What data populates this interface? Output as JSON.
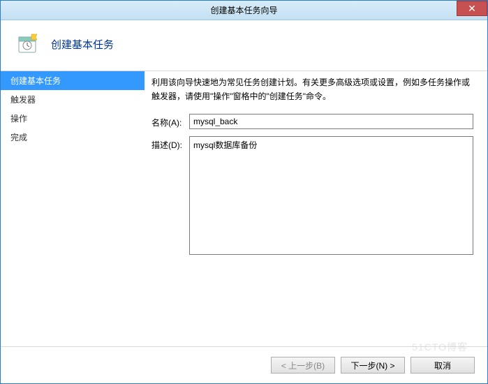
{
  "window": {
    "title": "创建基本任务向导"
  },
  "header": {
    "title": "创建基本任务"
  },
  "sidebar": {
    "items": [
      {
        "label": "创建基本任务",
        "active": true
      },
      {
        "label": "触发器",
        "active": false
      },
      {
        "label": "操作",
        "active": false
      },
      {
        "label": "完成",
        "active": false
      }
    ]
  },
  "content": {
    "intro": "利用该向导快速地为常见任务创建计划。有关更多高级选项或设置，例如多任务操作或触发器，请使用\"操作\"窗格中的\"创建任务\"命令。",
    "name_label": "名称(A):",
    "name_value": "mysql_back",
    "desc_label": "描述(D):",
    "desc_value": "mysql数据库备份"
  },
  "buttons": {
    "back": "< 上一步(B)",
    "next": "下一步(N) >",
    "cancel": "取消"
  },
  "watermark": "51CTO博客"
}
